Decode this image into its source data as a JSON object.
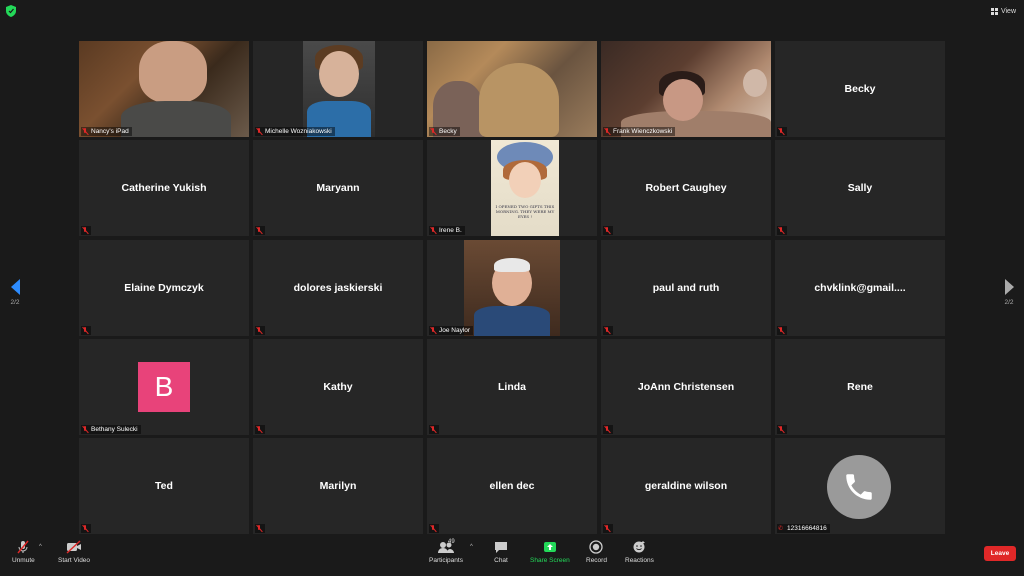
{
  "top": {
    "view_label": "View"
  },
  "pagination": {
    "left_page": "2/2",
    "right_page": "2/2"
  },
  "tiles": [
    {
      "name": "Nancy's iPad",
      "video": true
    },
    {
      "name": "Michelle Wozniakowski",
      "video": true
    },
    {
      "name": "Becky",
      "video": true
    },
    {
      "name": "Frank Wienczkowski",
      "video": true
    },
    {
      "name": "Becky",
      "video": false
    },
    {
      "name": "Catherine Yukish",
      "video": false
    },
    {
      "name": "Maryann",
      "video": false
    },
    {
      "name": "Irene B.",
      "video": true,
      "image_caption": "I OPENED TWO GIFTS THIS MORNING. THEY WERE MY EYES !"
    },
    {
      "name": "Robert Caughey",
      "video": false
    },
    {
      "name": "Sally",
      "video": false
    },
    {
      "name": "Elaine Dymczyk",
      "video": false
    },
    {
      "name": "dolores jaskierski",
      "video": false
    },
    {
      "name": "Joe Naylor",
      "video": true
    },
    {
      "name": "paul and ruth",
      "video": false
    },
    {
      "name": "chvklink@gmail....",
      "video": false
    },
    {
      "name": "Bethany Sulecki",
      "video": false,
      "avatar_letter": "B",
      "avatar_color": "#e8437a"
    },
    {
      "name": "Kathy",
      "video": false
    },
    {
      "name": "Linda",
      "video": false
    },
    {
      "name": "JoAnn Christensen",
      "video": false
    },
    {
      "name": "Rene",
      "video": false
    },
    {
      "name": "Ted",
      "video": false
    },
    {
      "name": "Marilyn",
      "video": false
    },
    {
      "name": "ellen dec",
      "video": false
    },
    {
      "name": "geraldine wilson",
      "video": false
    },
    {
      "name": "12316664816",
      "video": false,
      "phone": true
    }
  ],
  "toolbar": {
    "unmute": "Unmute",
    "start_video": "Start Video",
    "participants": "Participants",
    "participants_count": "49",
    "chat": "Chat",
    "share_screen": "Share Screen",
    "record": "Record",
    "reactions": "Reactions",
    "leave": "Leave"
  },
  "colors": {
    "share_screen_green": "#23d959",
    "leave_red": "#e02828",
    "accent_blue": "#2d8cff"
  }
}
